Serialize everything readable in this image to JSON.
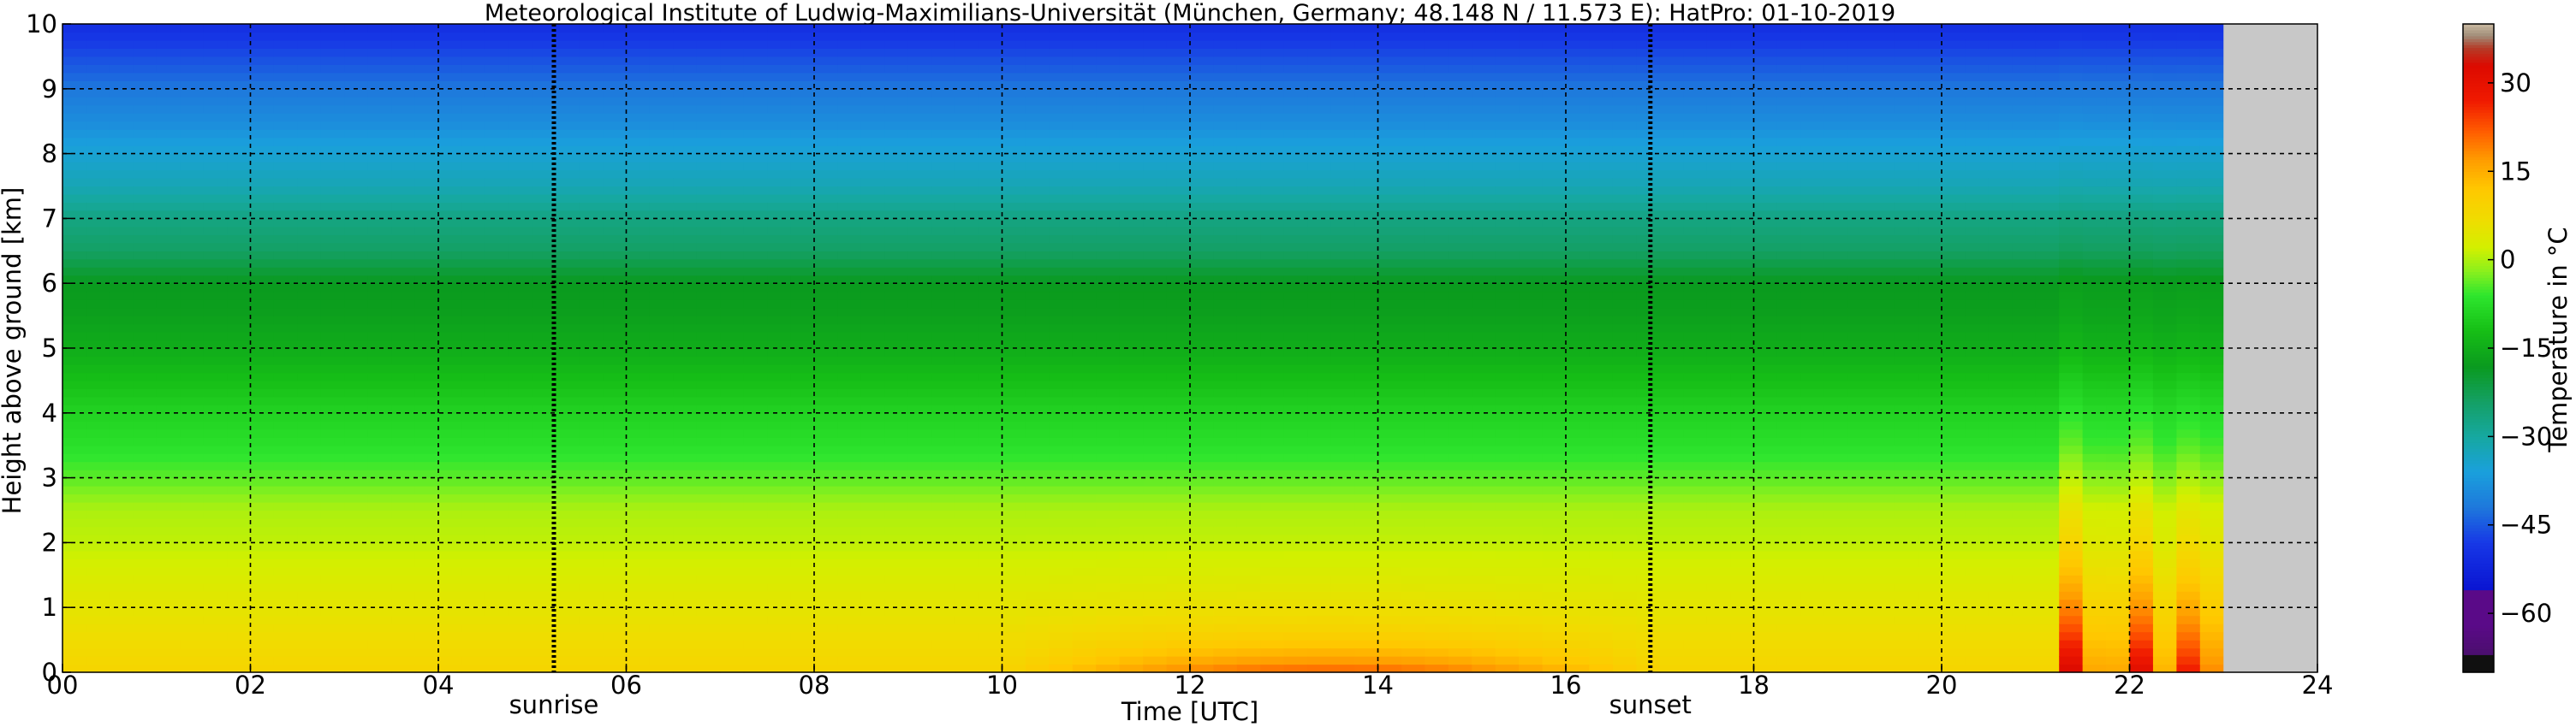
{
  "chart_data": {
    "type": "heatmap",
    "title": "Meteorological Institute of Ludwig-Maximilians-Universität (München, Germany; 48.148 N / 11.573 E):    HatPro: 01-10-2019",
    "xlabel": "Time [UTC]",
    "ylabel": "Height above ground [km]",
    "xlim": [
      0,
      24
    ],
    "ylim": [
      0,
      10
    ],
    "x_ticks": [
      "00",
      "02",
      "04",
      "06",
      "08",
      "10",
      "12",
      "14",
      "16",
      "18",
      "20",
      "22",
      "24"
    ],
    "y_ticks": [
      "0",
      "1",
      "2",
      "3",
      "4",
      "5",
      "6",
      "7",
      "8",
      "9",
      "10"
    ],
    "grid": true,
    "data_end_hour": 23.0,
    "missing_color": "#c8c8c8",
    "annotations": [
      {
        "label": "sunrise",
        "x": 5.23
      },
      {
        "label": "sunset",
        "x": 16.9
      }
    ],
    "temperature_profile": {
      "heights_km": [
        0,
        0.5,
        1,
        1.5,
        2,
        2.5,
        3,
        3.5,
        4,
        4.5,
        5,
        5.5,
        6,
        6.5,
        7,
        7.5,
        8,
        8.5,
        9,
        9.5,
        10
      ],
      "temps_degC": [
        9,
        7,
        5,
        3,
        1,
        0,
        -4,
        -7,
        -9,
        -12,
        -15,
        -17,
        -18,
        -24,
        -27,
        -32,
        -35,
        -39,
        -42,
        -46,
        -50
      ]
    },
    "afternoon_surface_heating": {
      "from_hour": 10,
      "to_hour": 17,
      "peak_hour": 13,
      "peak_temp_degC": 22
    },
    "evening_warm_plumes": [
      {
        "center_hour": 21.4,
        "peak_temp_degC": 30
      },
      {
        "center_hour": 22.1,
        "peak_temp_degC": 28
      },
      {
        "center_hour": 22.7,
        "peak_temp_degC": 27
      }
    ],
    "colorbar": {
      "label": "Temperature in °C",
      "ticks": [
        "30",
        "15",
        "0",
        "−15",
        "−30",
        "−45",
        "−60"
      ],
      "tick_values": [
        30,
        15,
        0,
        -15,
        -30,
        -45,
        -60
      ],
      "vmin": -70,
      "vmax": 40
    }
  }
}
